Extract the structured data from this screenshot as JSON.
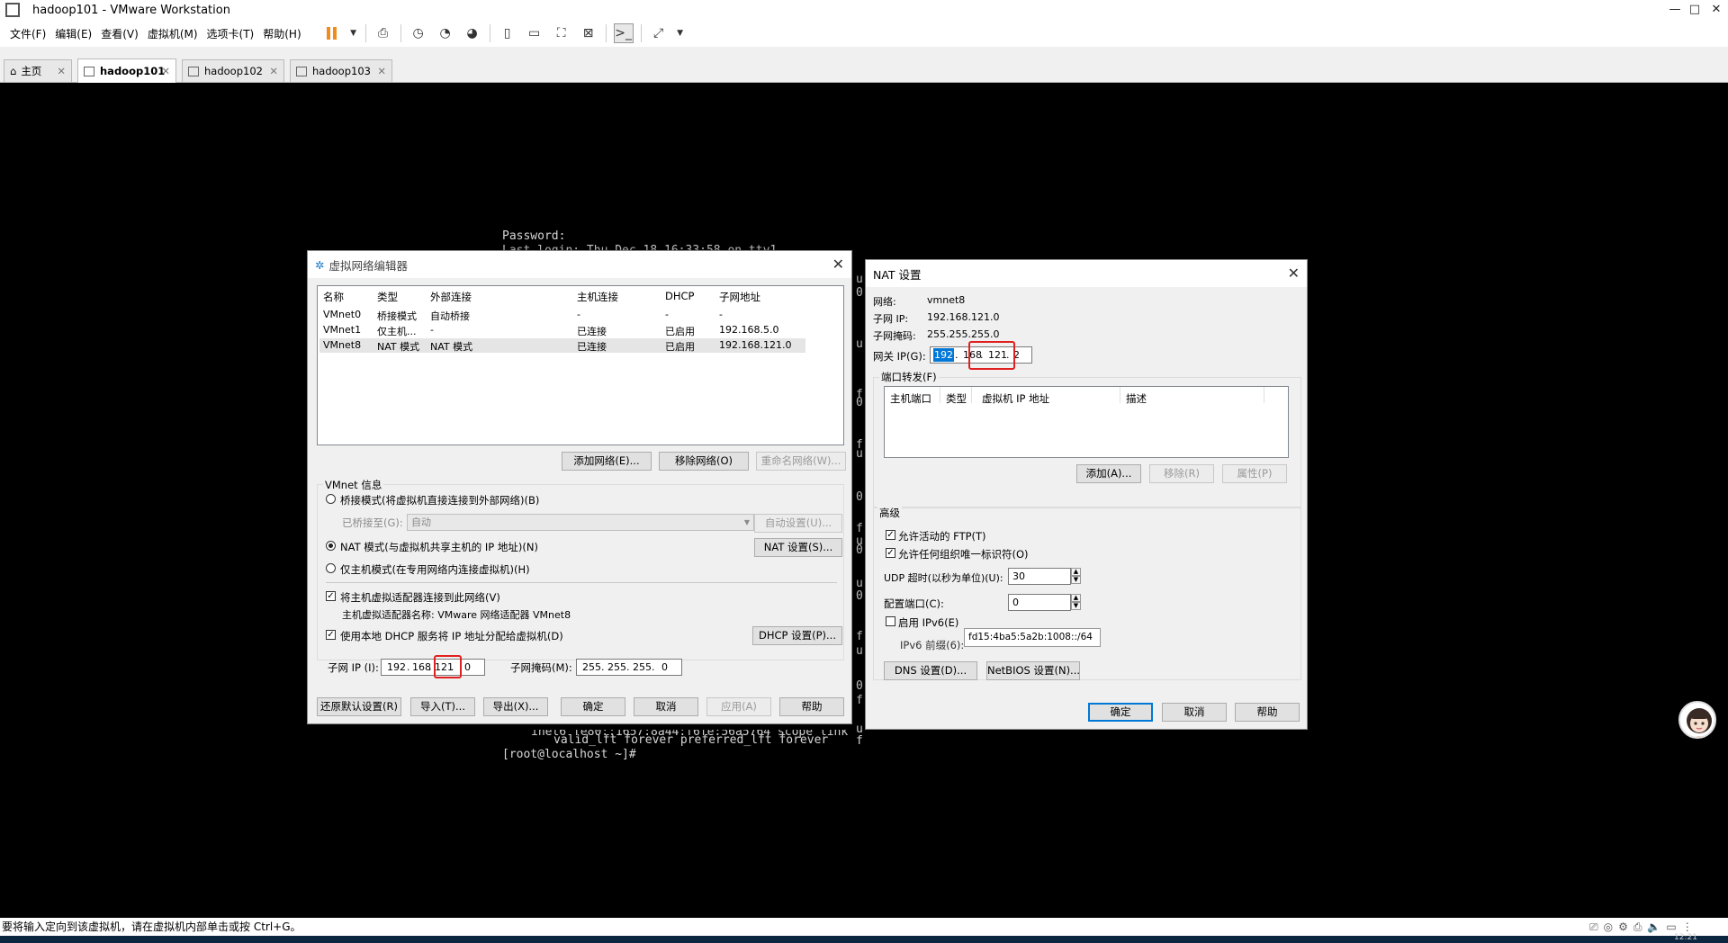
{
  "window": {
    "title": "hadoop101 - VMware Workstation",
    "controls": [
      "—",
      "□",
      "✕"
    ]
  },
  "menu": [
    "文件(F)",
    "编辑(E)",
    "查看(V)",
    "虚拟机(M)",
    "选项卡(T)",
    "帮助(H)"
  ],
  "tabs": [
    {
      "label": "主页"
    },
    {
      "label": "hadoop101"
    },
    {
      "label": "hadoop102"
    },
    {
      "label": "hadoop103"
    }
  ],
  "terminal": {
    "password_line": "Password:",
    "last_login": "Last login: Thu Dec 18 16:33:58 on tty1",
    "inet6_line": "inet6 fe80::1657:8a44:f6fe:56a5764 scope link",
    "valid_line": "valid_lft forever preferred_lft forever",
    "prompt": "[root@localhost ~]#",
    "right_chars": [
      "u",
      "0",
      "u",
      "f",
      "0",
      "f",
      "u",
      "0",
      "f",
      "u",
      "0",
      "u",
      "0",
      "f",
      "u",
      "0",
      "f",
      "u",
      "f"
    ]
  },
  "vne": {
    "title": "虚拟网络编辑器",
    "columns": [
      "名称",
      "类型",
      "外部连接",
      "主机连接",
      "DHCP",
      "子网地址"
    ],
    "rows": [
      [
        "VMnet0",
        "桥接模式",
        "自动桥接",
        "-",
        "-",
        "-"
      ],
      [
        "VMnet1",
        "仅主机...",
        "-",
        "已连接",
        "已启用",
        "192.168.5.0"
      ],
      [
        "VMnet8",
        "NAT 模式",
        "NAT 模式",
        "已连接",
        "已启用",
        "192.168.121.0"
      ]
    ],
    "btn_add": "添加网络(E)...",
    "btn_remove": "移除网络(O)",
    "btn_rename": "重命名网络(W)...",
    "info_title": "VMnet 信息",
    "radio_bridge": "桥接模式(将虚拟机直接连接到外部网络)(B)",
    "bridged_to_label": "已桥接至(G):",
    "bridged_to_value": "自动",
    "btn_auto": "自动设置(U)...",
    "radio_nat": "NAT 模式(与虚拟机共享主机的 IP 地址)(N)",
    "btn_nat": "NAT 设置(S)...",
    "radio_host": "仅主机模式(在专用网络内连接虚拟机)(H)",
    "chk_adapter": "将主机虚拟适配器连接到此网络(V)",
    "adapter_name": "主机虚拟适配器名称: VMware 网络适配器 VMnet8",
    "chk_dhcp": "使用本地 DHCP 服务将 IP 地址分配给虚拟机(D)",
    "btn_dhcp": "DHCP 设置(P)...",
    "subnet_ip_label": "子网 IP (I):",
    "subnet_ip": [
      "192",
      "168",
      "121",
      "0"
    ],
    "mask_label": "子网掩码(M):",
    "mask": [
      "255",
      "255",
      "255",
      "0"
    ],
    "btn_restore": "还原默认设置(R)",
    "btn_import": "导入(T)...",
    "btn_export": "导出(X)...",
    "btn_ok": "确定",
    "btn_cancel": "取消",
    "btn_apply": "应用(A)",
    "btn_help": "帮助"
  },
  "nat": {
    "title": "NAT 设置",
    "network_label": "网络:",
    "network": "vmnet8",
    "subnet_label": "子网 IP:",
    "subnet": "192.168.121.0",
    "mask_label": "子网掩码:",
    "mask": "255.255.255.0",
    "gateway_label": "网关 IP(G):",
    "gateway": [
      "192",
      "168",
      "121",
      "2"
    ],
    "pf_title": "端口转发(F)",
    "pf_columns": [
      "主机端口",
      "类型",
      "虚拟机 IP 地址",
      "描述"
    ],
    "btn_add": "添加(A)...",
    "btn_remove": "移除(R)",
    "btn_props": "属性(P)",
    "adv_title": "高级",
    "chk_ftp": "允许活动的 FTP(T)",
    "chk_oui": "允许任何组织唯一标识符(O)",
    "udp_label": "UDP 超时(以秒为单位)(U):",
    "udp_value": "30",
    "cfg_port_label": "配置端口(C):",
    "cfg_port_value": "0",
    "chk_ipv6": "启用 IPv6(E)",
    "ipv6_label": "IPv6 前缀(6):",
    "ipv6_value": "fd15:4ba5:5a2b:1008::/64",
    "btn_dns": "DNS 设置(D)...",
    "btn_netbios": "NetBIOS 设置(N)...",
    "btn_ok": "确定",
    "btn_cancel": "取消",
    "btn_help": "帮助"
  },
  "status": {
    "text": "要将输入定向到该虚拟机，请在虚拟机内部单击或按 Ctrl+G。",
    "clock": "12:21"
  },
  "colors": {
    "highlight": "#e02020",
    "selection": "#0078d7",
    "accent_pause": "#f08c1e"
  }
}
